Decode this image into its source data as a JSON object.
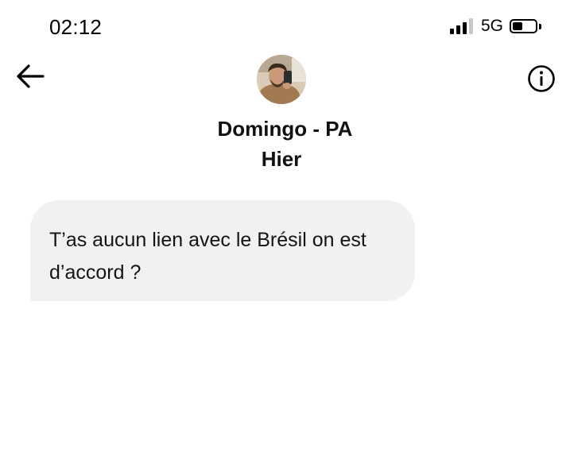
{
  "status_bar": {
    "time": "02:12",
    "network": "5G",
    "signal_bars": 3,
    "signal_bars_total": 4,
    "battery_level": 0.45
  },
  "header": {
    "back_icon": "arrow-left-icon",
    "info_icon": "info-circle-icon",
    "avatar_icon": "contact-photo",
    "contact_name": "Domingo - PA",
    "date": "Hier"
  },
  "messages": [
    {
      "direction": "incoming",
      "text": "T’as aucun lien avec le Brésil on est d’accord ?"
    }
  ],
  "colors": {
    "bubble_background": "#eff1f2",
    "text": "#111111",
    "background": "#ffffff"
  }
}
